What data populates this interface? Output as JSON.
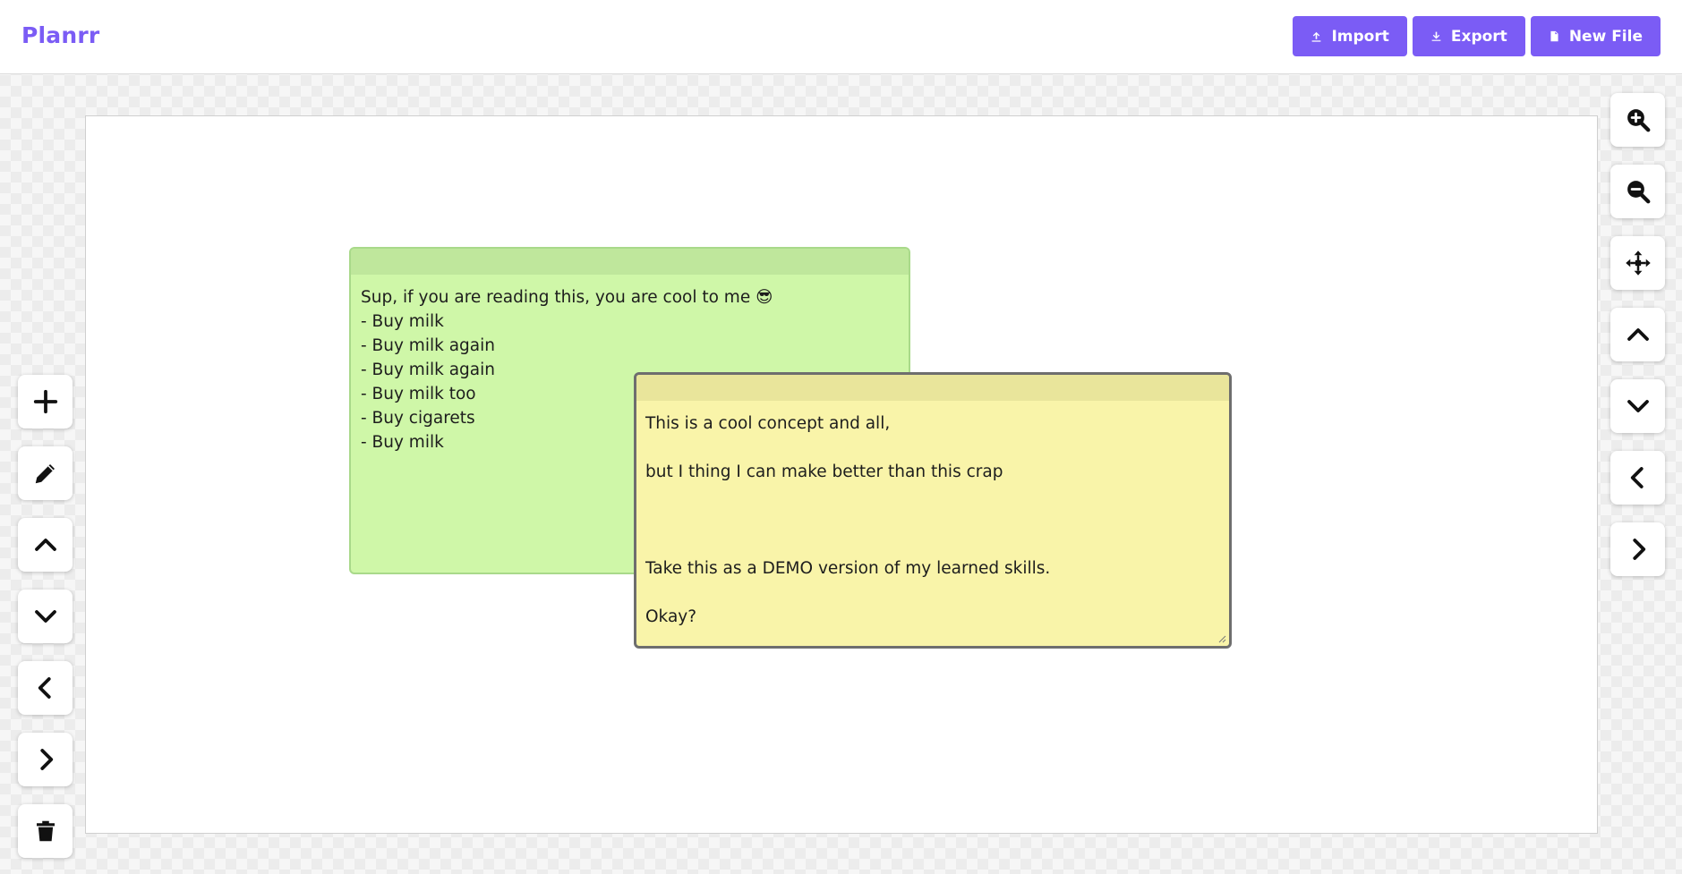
{
  "app": {
    "brand": "Planrr",
    "brand_color": "#7b5cf5"
  },
  "header": {
    "buttons": [
      {
        "label": "Import",
        "icon": "upload-icon"
      },
      {
        "label": "Export",
        "icon": "download-icon"
      },
      {
        "label": "New File",
        "icon": "file-icon"
      }
    ]
  },
  "notes": [
    {
      "color": "#cff7a8",
      "header_color": "#bfe79c",
      "text": "Sup, if you are reading this, you are cool to me 😎\n- Buy milk\n- Buy milk again\n- Buy milk again\n- Buy milk too\n- Buy cigarets\n- Buy milk"
    },
    {
      "color": "#f9f4a9",
      "header_color": "#e9e59b",
      "text": "This is a cool concept and all,\n\nbut I thing I can make better than this crap\n\n\n\nTake this as a DEMO version of my learned skills.\n\nOkay?"
    }
  ],
  "left_toolbar": [
    {
      "icon": "plus-icon"
    },
    {
      "icon": "pencil-icon"
    },
    {
      "icon": "chevron-up-icon"
    },
    {
      "icon": "chevron-down-icon"
    },
    {
      "icon": "chevron-left-icon"
    },
    {
      "icon": "chevron-right-icon"
    },
    {
      "icon": "trash-icon"
    }
  ],
  "right_toolbar": [
    {
      "icon": "zoom-in-icon"
    },
    {
      "icon": "zoom-out-icon"
    },
    {
      "icon": "move-arrows-icon"
    },
    {
      "icon": "chevron-up-icon"
    },
    {
      "icon": "chevron-down-icon"
    },
    {
      "icon": "chevron-left-icon"
    },
    {
      "icon": "chevron-right-icon"
    }
  ]
}
